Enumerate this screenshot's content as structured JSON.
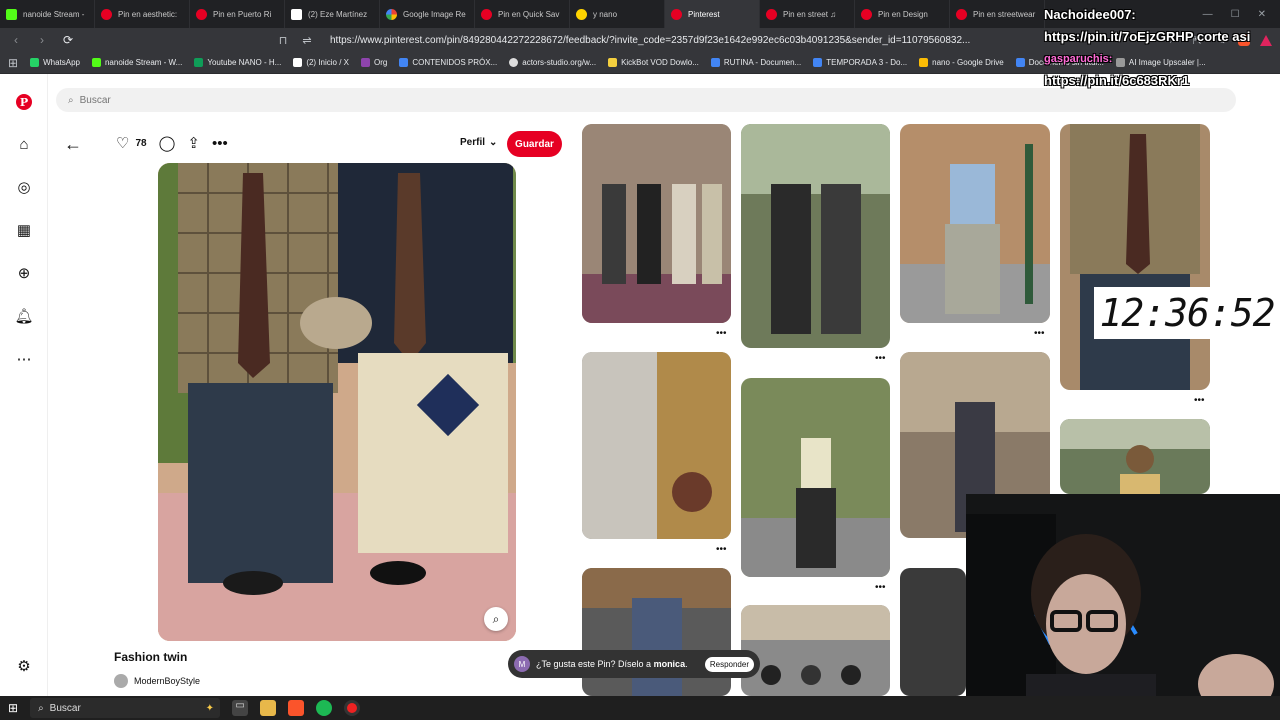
{
  "browser": {
    "tabs": [
      {
        "label": "nanoide Stream -",
        "icon": "kick-icon"
      },
      {
        "label": "Pin en aesthetic:",
        "icon": "pinterest-icon"
      },
      {
        "label": "Pin en Puerto Ri",
        "icon": "pinterest-icon"
      },
      {
        "label": "(2) Eze Martínez",
        "icon": "x-icon"
      },
      {
        "label": "Google Image Re",
        "icon": "google-icon"
      },
      {
        "label": "Pin en Quick Sav",
        "icon": "pinterest-icon"
      },
      {
        "label": "y nano",
        "icon": "folder-icon"
      },
      {
        "label": "Pinterest",
        "icon": "pinterest-icon"
      },
      {
        "label": "Pin en street ♫",
        "icon": "pinterest-icon"
      },
      {
        "label": "Pin en Design",
        "icon": "pinterest-icon"
      },
      {
        "label": "Pin en streetwear",
        "icon": "pinterest-icon"
      }
    ],
    "url": "https://www.pinterest.com/pin/849280442272228672/feedback/?invite_code=2357d9f23e1642e992ec6c03b4091235&sender_id=11079560832...",
    "bookmarks": [
      {
        "label": "WhatsApp",
        "color": "#25d366"
      },
      {
        "label": "nanoide Stream - W...",
        "color": "#53fc18"
      },
      {
        "label": "Youtube NANO - H...",
        "color": "#0f9d58"
      },
      {
        "label": "(2) Inicio / X",
        "color": "#ffffff"
      },
      {
        "label": "Org",
        "color": "#8e44ad"
      },
      {
        "label": "CONTENIDOS PRÓX...",
        "color": "#4285f4"
      },
      {
        "label": "actors-studio.org/w...",
        "color": "#dddddd"
      },
      {
        "label": "KickBot VOD Dowlo...",
        "color": "#f4d03f"
      },
      {
        "label": "RUTINA - Documen...",
        "color": "#4285f4"
      },
      {
        "label": "TEMPORADA 3 - Do...",
        "color": "#4285f4"
      },
      {
        "label": "nano - Google Drive",
        "color": "#fbbc05"
      },
      {
        "label": "Documento sin títul...",
        "color": "#4285f4"
      },
      {
        "label": "AI Image Upscaler |...",
        "color": "#999999"
      }
    ]
  },
  "pinterest": {
    "search_placeholder": "Buscar",
    "likes": "78",
    "profile_select": "Perfil",
    "save_label": "Guardar",
    "pin_title": "Fashion twin",
    "author": "ModernBoyStyle",
    "toast": {
      "avatar_letter": "M",
      "text": "¿Te gusta este Pin? Díselo a ",
      "name": "monica",
      "name_suffix": ".",
      "button": "Responder"
    }
  },
  "overlay": {
    "chat_user_1": "Nachoidee007:",
    "chat_msg_1": "https://pin.it/7oEjzGRHP corte asi",
    "chat_user_2": "gasparuchis:",
    "chat_msg_2": "https://pin.it/6c683RKr1",
    "clock": "12:36:52"
  },
  "taskbar": {
    "search_placeholder": "Buscar"
  },
  "colors": {
    "pinterest_red": "#e60023",
    "chrome_dark": "#202124",
    "taskbar": "#1f1f1f"
  }
}
